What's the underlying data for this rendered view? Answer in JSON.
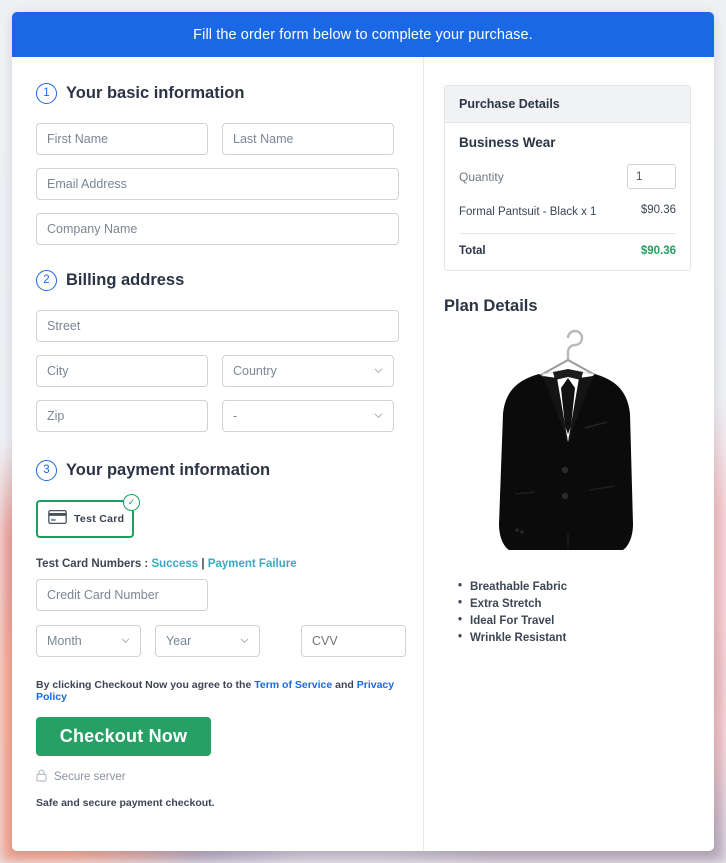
{
  "banner": {
    "text": "Fill the order form below to complete your purchase."
  },
  "colors": {
    "banner_blue": "#1a68e5",
    "accent_blue": "#1a68e5",
    "success_green": "#26a065",
    "card_border_green": "#16a15e",
    "total_green": "#21a05f",
    "link_teal": "#3aa9c4"
  },
  "sections": {
    "basic": {
      "number": "1",
      "title": "Your basic information",
      "fields": {
        "first_name": {
          "placeholder": "First Name",
          "value": ""
        },
        "last_name": {
          "placeholder": "Last Name",
          "value": ""
        },
        "email": {
          "placeholder": "Email Address",
          "value": ""
        },
        "company": {
          "placeholder": "Company Name",
          "value": ""
        }
      }
    },
    "billing": {
      "number": "2",
      "title": "Billing address",
      "fields": {
        "street": {
          "placeholder": "Street",
          "value": ""
        },
        "city": {
          "placeholder": "City",
          "value": ""
        },
        "country": {
          "selected": "Country"
        },
        "zip": {
          "placeholder": "Zip",
          "value": ""
        },
        "state": {
          "selected": "-"
        }
      }
    },
    "payment": {
      "number": "3",
      "title": "Your payment information",
      "card_option": {
        "label": "Test  Card",
        "selected": true,
        "icon": "credit-card-icon",
        "badge": "check-icon"
      },
      "test_numbers": {
        "label": "Test Card Numbers :",
        "success_link": "Success",
        "separator": "|",
        "failure_link": "Payment Failure"
      },
      "fields": {
        "credit_card": {
          "placeholder": "Credit Card Number",
          "value": ""
        },
        "month": {
          "selected": "Month"
        },
        "year": {
          "selected": "Year"
        },
        "cvv": {
          "placeholder": "CVV",
          "value": ""
        }
      },
      "terms": {
        "prefix": "By clicking Checkout Now you agree to the ",
        "tos": "Term of Service",
        "middle": " and ",
        "privacy": "Privacy Policy"
      },
      "checkout_button": "Checkout Now",
      "secure_server": "Secure server",
      "safe_note": "Safe and secure payment checkout."
    }
  },
  "purchase": {
    "header": "Purchase Details",
    "product_title": "Business Wear",
    "quantity_label": "Quantity",
    "quantity_value": "1",
    "line_item": {
      "name": "Formal Pantsuit - Black x 1",
      "amount": "$90.36"
    },
    "total_label": "Total",
    "total_amount": "$90.36"
  },
  "plan": {
    "title": "Plan Details",
    "image_alt": "black-suit-jacket-on-hanger",
    "features": [
      "Breathable Fabric",
      "Extra Stretch",
      "Ideal For Travel",
      "Wrinkle Resistant"
    ]
  }
}
